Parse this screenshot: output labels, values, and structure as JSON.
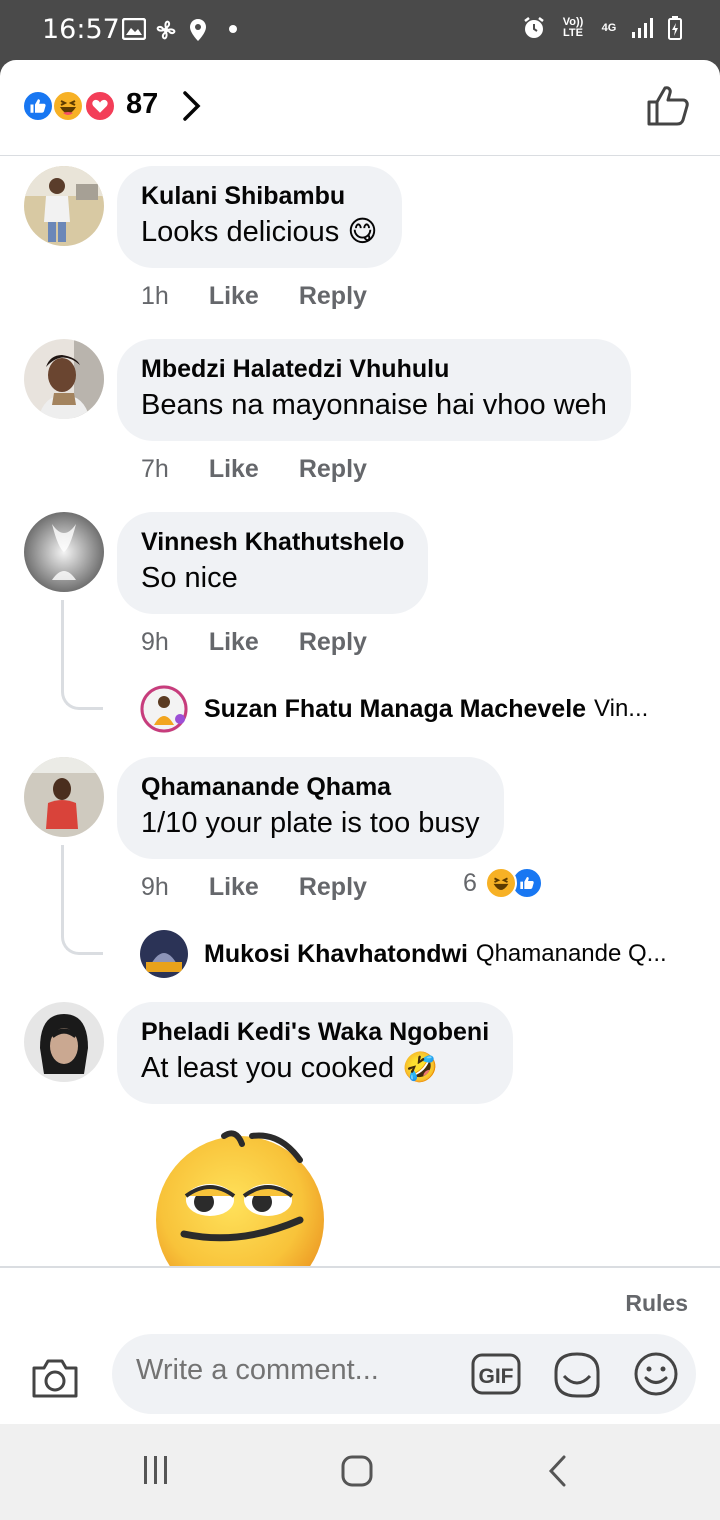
{
  "status_bar": {
    "time": "16:57",
    "network": "4G",
    "volte": "Vo)) LTE"
  },
  "header": {
    "reaction_count": "87",
    "reaction_icons": [
      "like-icon",
      "haha-icon",
      "love-icon"
    ]
  },
  "comments": [
    {
      "name": "Kulani Shibambu",
      "text": "Looks delicious 😋",
      "time": "1h",
      "like": "Like",
      "reply": "Reply"
    },
    {
      "name": "Mbedzi Halatedzi Vhuhulu",
      "text": "Beans na mayonnaise hai vhoo weh",
      "time": "7h",
      "like": "Like",
      "reply": "Reply"
    },
    {
      "name": "Vinnesh Khathutshelo",
      "text": "So nice",
      "time": "9h",
      "like": "Like",
      "reply": "Reply",
      "reply_preview": {
        "name": "Suzan Fhatu Managa Machevele",
        "text": "Vin..."
      }
    },
    {
      "name": "Qhamanande Qhama",
      "text": "1/10 your plate is too busy",
      "time": "9h",
      "like": "Like",
      "reply": "Reply",
      "reaction_count": "6",
      "reply_preview": {
        "name": "Mukosi Khavhatondwi",
        "text": "Qhamanande Q..."
      }
    },
    {
      "name": "Pheladi Kedi's Waka Ngobeni",
      "text": "At least you cooked 🤣",
      "time": "",
      "like": "",
      "reply": ""
    }
  ],
  "composer": {
    "rules": "Rules",
    "placeholder": "Write a comment...",
    "gif": "GIF"
  },
  "colors": {
    "like_blue": "#1877f2",
    "haha_yellow": "#f7b125",
    "love_red": "#f33e58",
    "bubble_bg": "#f0f2f5",
    "meta_gray": "#65676b"
  }
}
